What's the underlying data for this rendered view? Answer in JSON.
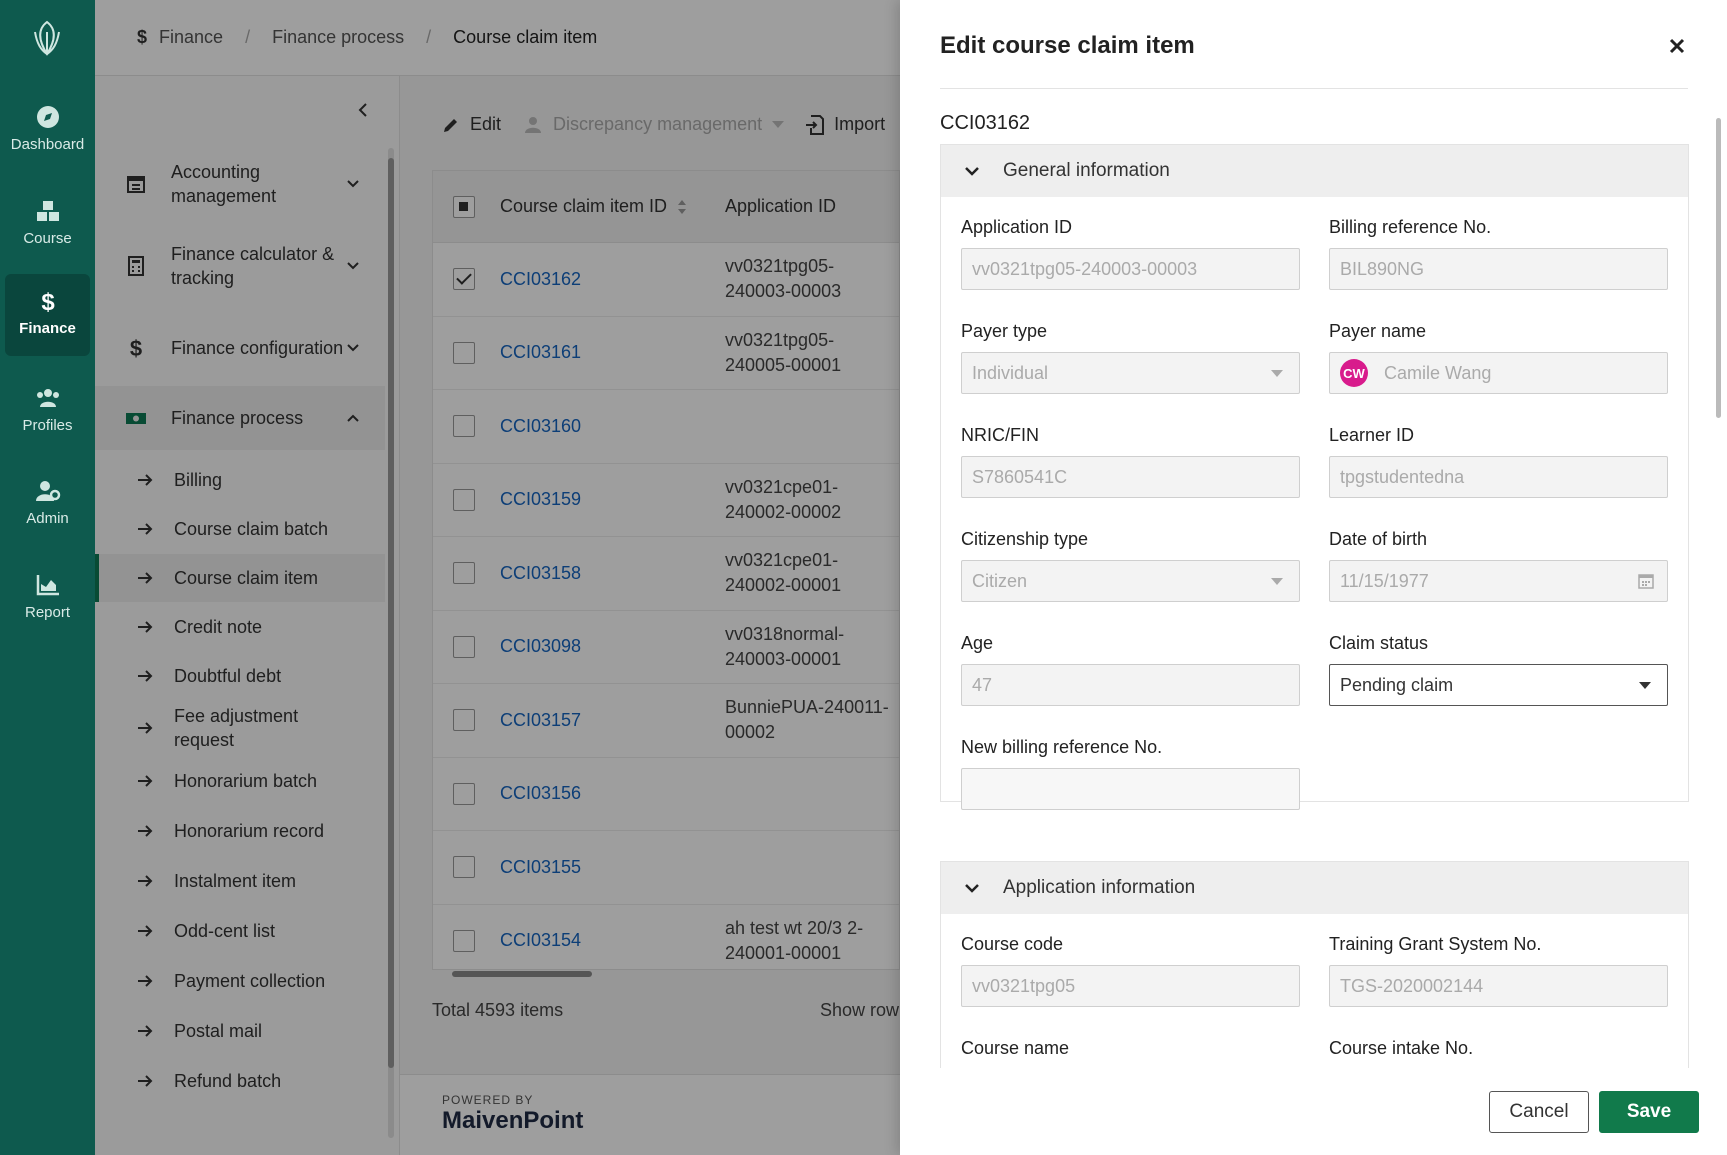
{
  "rail": {
    "items": [
      {
        "label": "Dashboard",
        "icon": "compass-icon"
      },
      {
        "label": "Course",
        "icon": "cubes-icon"
      },
      {
        "label": "Finance",
        "icon": "dollar-icon"
      },
      {
        "label": "Profiles",
        "icon": "users-icon"
      },
      {
        "label": "Admin",
        "icon": "user-gear-icon"
      },
      {
        "label": "Report",
        "icon": "chart-area-icon"
      }
    ],
    "active": "Finance"
  },
  "breadcrumb": {
    "items": [
      "Finance",
      "Finance process",
      "Course claim item"
    ]
  },
  "sidenav": {
    "groups": [
      {
        "label": "Accounting management"
      },
      {
        "label": "Finance calculator & tracking"
      },
      {
        "label": "Finance configuration"
      },
      {
        "label": "Finance process"
      }
    ],
    "subitems": [
      "Billing",
      "Course claim batch",
      "Course claim item",
      "Credit note",
      "Doubtful debt",
      "Fee adjustment request",
      "Honorarium batch",
      "Honorarium record",
      "Instalment item",
      "Odd-cent list",
      "Payment collection",
      "Postal mail",
      "Refund batch"
    ],
    "active_subitem": "Course claim item"
  },
  "toolbar": {
    "edit": "Edit",
    "discrepancy": "Discrepancy management",
    "import": "Import"
  },
  "table": {
    "columns": [
      "Course claim item ID",
      "Application ID"
    ],
    "rows": [
      {
        "id": "CCI03162",
        "app": "vv0321tpg05-240003-00003",
        "checked": true
      },
      {
        "id": "CCI03161",
        "app": "vv0321tpg05-240005-00001",
        "checked": false
      },
      {
        "id": "CCI03160",
        "app": "",
        "checked": false
      },
      {
        "id": "CCI03159",
        "app": "vv0321cpe01-240002-00002",
        "checked": false
      },
      {
        "id": "CCI03158",
        "app": "vv0321cpe01-240002-00001",
        "checked": false
      },
      {
        "id": "CCI03098",
        "app": "vv0318normal-240003-00001",
        "checked": false
      },
      {
        "id": "CCI03157",
        "app": "BunniePUA-240011-00002",
        "checked": false
      },
      {
        "id": "CCI03156",
        "app": "",
        "checked": false
      },
      {
        "id": "CCI03155",
        "app": "",
        "checked": false
      },
      {
        "id": "CCI03154",
        "app": "ah test wt 20/3 2-240001-00001",
        "checked": false
      }
    ],
    "total": "Total 4593 items",
    "show_rows": "Show row"
  },
  "footer": {
    "powered_by": "POWERED BY",
    "brand": "MaivenPoint"
  },
  "drawer": {
    "title": "Edit course claim item",
    "record_id": "CCI03162",
    "general_section": "General information",
    "fields": {
      "application_id": {
        "label": "Application ID",
        "value": "vv0321tpg05-240003-00003"
      },
      "billing_ref": {
        "label": "Billing reference No.",
        "value": "BIL890NG"
      },
      "payer_type": {
        "label": "Payer type",
        "value": "Individual"
      },
      "payer_name": {
        "label": "Payer name",
        "value": "Camile Wang",
        "initials": "CW"
      },
      "nric": {
        "label": "NRIC/FIN",
        "value": "S7860541C"
      },
      "learner_id": {
        "label": "Learner ID",
        "value": "tpgstudentedna"
      },
      "citizenship": {
        "label": "Citizenship type",
        "value": "Citizen"
      },
      "dob": {
        "label": "Date of birth",
        "value": "11/15/1977"
      },
      "age": {
        "label": "Age",
        "value": "47"
      },
      "claim_status": {
        "label": "Claim status",
        "value": "Pending claim"
      },
      "new_billing_ref": {
        "label": "New billing reference No.",
        "value": ""
      }
    },
    "application_section": "Application information",
    "app_fields": {
      "course_code": {
        "label": "Course code",
        "value": "vv0321tpg05"
      },
      "tgs_no": {
        "label": "Training Grant System No.",
        "value": "TGS-2020002144"
      },
      "course_name": {
        "label": "Course name"
      },
      "intake_no": {
        "label": "Course intake No."
      }
    },
    "cancel": "Cancel",
    "save": "Save"
  },
  "colors": {
    "rail": "#0e5a4e",
    "link": "#1565c0",
    "primary_button": "#117a4b",
    "avatar": "#d81b8c"
  }
}
